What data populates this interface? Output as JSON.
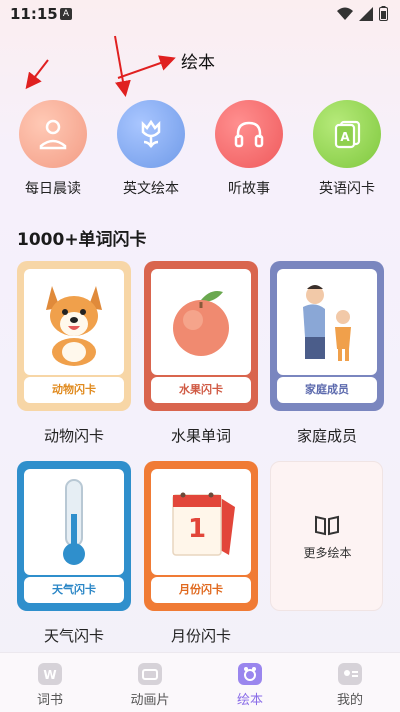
{
  "status": {
    "time": "11:15",
    "notif_letter": "A"
  },
  "annotation": {
    "text": "绘本"
  },
  "top_nav": [
    {
      "label": "每日晨读",
      "icon": "person-reading-icon",
      "color": "#f4a08c"
    },
    {
      "label": "英文绘本",
      "icon": "tulip-icon",
      "color": "#7aa8f2"
    },
    {
      "label": "听故事",
      "icon": "headphones-icon",
      "color": "#f36a6d"
    },
    {
      "label": "英语闪卡",
      "icon": "letter-card-icon",
      "color": "#8fd44e"
    }
  ],
  "section": {
    "title": "1000+单词闪卡"
  },
  "cards": [
    {
      "tag": "动物闪卡",
      "label": "动物闪卡",
      "image": "corgi-dog",
      "frame_color": "#f7d6a6",
      "tag_color": "#e08a1e"
    },
    {
      "tag": "水果闪卡",
      "label": "水果单词",
      "image": "peach",
      "frame_color": "#d9654e",
      "tag_color": "#d05a44"
    },
    {
      "tag": "家庭成员",
      "label": "家庭成员",
      "image": "parent-and-child",
      "frame_color": "#7a86bf",
      "tag_color": "#5b69ad"
    },
    {
      "tag": "天气闪卡",
      "label": "天气闪卡",
      "image": "thermometer",
      "frame_color": "#2f8fcc",
      "tag_color": "#2a86c6"
    },
    {
      "tag": "月份闪卡",
      "label": "月份闪卡",
      "image": "calendar",
      "frame_color": "#f07b35",
      "tag_color": "#e0691f"
    }
  ],
  "more": {
    "label": "更多绘本",
    "icon": "open-book-icon"
  },
  "tabs": [
    {
      "label": "词书",
      "icon": "word-book-icon",
      "active": false
    },
    {
      "label": "动画片",
      "icon": "cartoon-tv-icon",
      "active": false
    },
    {
      "label": "绘本",
      "icon": "picture-book-icon",
      "active": true
    },
    {
      "label": "我的",
      "icon": "profile-card-icon",
      "active": false
    }
  ]
}
